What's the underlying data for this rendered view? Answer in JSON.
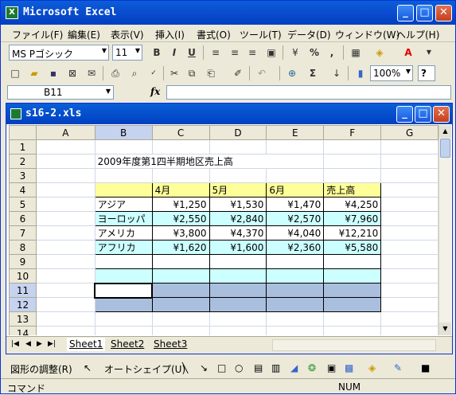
{
  "app": {
    "title": "Microsoft Excel",
    "icon": "excel-icon"
  },
  "window_buttons": {
    "minimize": "_",
    "maximize": "□",
    "close": "✕"
  },
  "menu": [
    "ファイル(F)",
    "編集(E)",
    "表示(V)",
    "挿入(I)",
    "書式(O)",
    "ツール(T)",
    "データ(D)",
    "ウィンドウ(W)",
    "ヘルプ(H)"
  ],
  "toolbar": {
    "font_name": "MS Pゴシック",
    "font_size": "11",
    "bold": "B",
    "italic": "I",
    "underline": "U",
    "percent": "%",
    "comma": ",",
    "zoom": "100%",
    "sum": "Σ",
    "help": "?"
  },
  "formula_bar": {
    "name_box": "B11",
    "fx": "fx",
    "value": ""
  },
  "workbook": {
    "title": "s16-2.xls"
  },
  "sheet": {
    "columns": [
      "",
      "A",
      "B",
      "C",
      "D",
      "E",
      "F",
      "G"
    ],
    "title_cell": "2009年度第1四半期地区売上高",
    "header": [
      "",
      "4月",
      "5月",
      "6月",
      "売上高"
    ],
    "rows": [
      [
        "アジア",
        "¥1,250",
        "¥1,530",
        "¥1,470",
        "¥4,250"
      ],
      [
        "ヨーロッパ",
        "¥2,550",
        "¥2,840",
        "¥2,570",
        "¥7,960"
      ],
      [
        "アメリカ",
        "¥3,800",
        "¥4,370",
        "¥4,040",
        "¥12,210"
      ],
      [
        "アフリカ",
        "¥1,620",
        "¥1,600",
        "¥2,360",
        "¥5,580"
      ]
    ],
    "row_numbers": [
      "1",
      "2",
      "3",
      "4",
      "5",
      "6",
      "7",
      "8",
      "9",
      "10",
      "11",
      "12",
      "13",
      "14"
    ],
    "selected_cell": "B11"
  },
  "tabs": [
    "Sheet1",
    "Sheet2",
    "Sheet3"
  ],
  "drawing_bar": {
    "adjust": "図形の調整(R)",
    "autoshape": "オートシェイプ(U)"
  },
  "status": {
    "mode": "コマンド",
    "num": "NUM"
  }
}
